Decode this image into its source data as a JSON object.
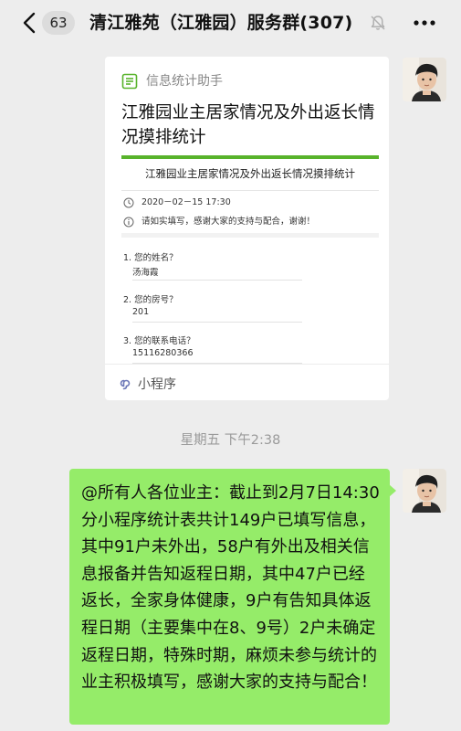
{
  "nav": {
    "back_icon": "chevron-left-icon",
    "unread_count": "63",
    "title": "清江雅苑（江雅园）服务群(307)",
    "mute_icon": "bell-muted-icon",
    "more_icon": "more-dots-icon"
  },
  "card": {
    "source_icon": "form-list-icon",
    "source_color": "#58b32b",
    "source_name": "信息统计助手",
    "title": "江雅园业主居家情况及外出返长情况摸排统计",
    "preview": {
      "title": "江雅园业主居家情况及外出返长情况摸排统计",
      "datetime": "2020－02－15 17:30",
      "notice": "请如实填写，感谢大家的支持与配合，谢谢！",
      "questions": [
        {
          "label": "1. 您的姓名？",
          "answer": "汤海霞"
        },
        {
          "label": "2. 您的房号？",
          "answer": "201"
        },
        {
          "label": "3. 您的联系电话？",
          "answer": "15116280366"
        }
      ]
    },
    "footer_icon": "mini-program-icon",
    "footer_label": "小程序"
  },
  "timestamp": "星期五 下午2:38",
  "message": {
    "text": "@所有人各位业主：截止到2月7日14:30分小程序统计表共计149户已填写信息，其中91户未外出，58户有外出及相关信息报备并告知返程日期，其中47户已经返长，全家身体健康，9户有告知具体返程日期（主要集中在8、9号）2户未确定返程日期，特殊时期，麻烦未参与统计的业主积极填写，感谢大家的支持与配合！",
    "bubble_color": "#95ec69"
  },
  "avatars": {
    "icon": "user-avatar-icon"
  }
}
